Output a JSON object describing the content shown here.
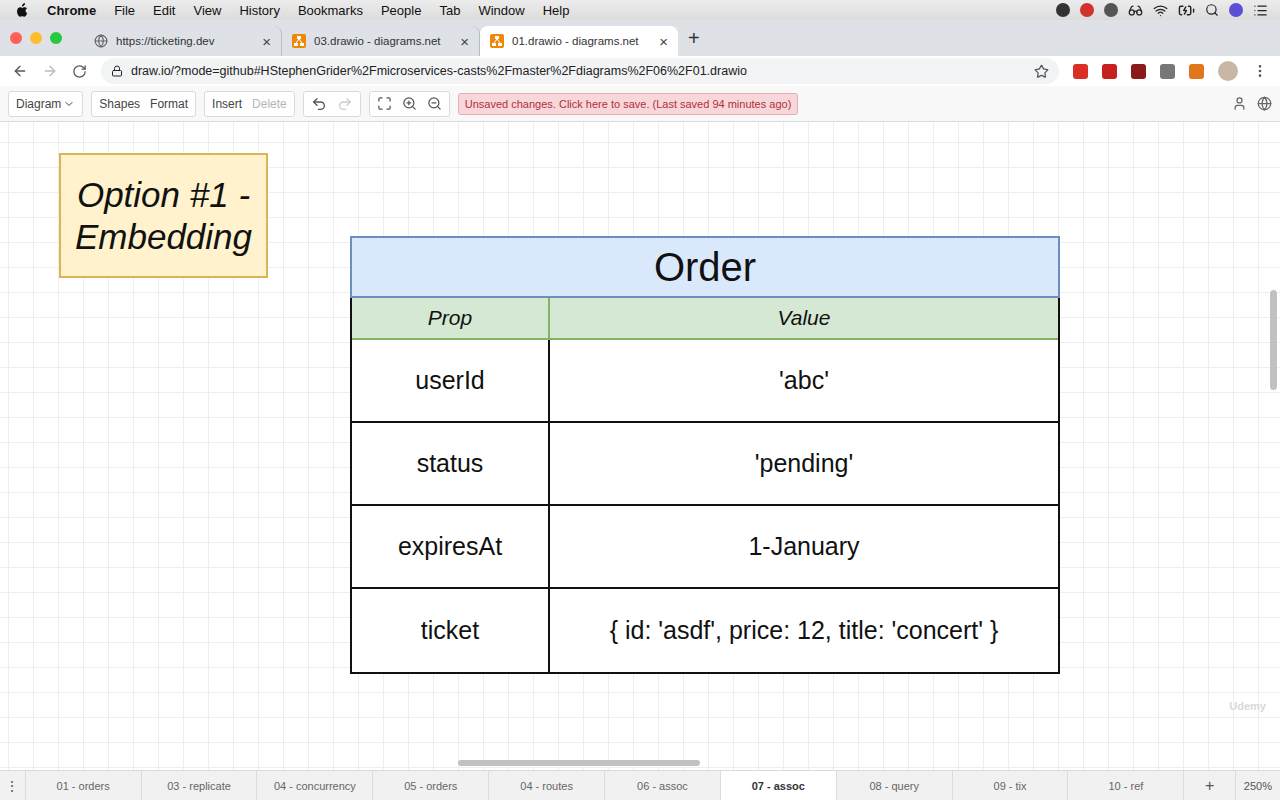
{
  "menubar": {
    "app": "Chrome",
    "items": [
      "File",
      "Edit",
      "View",
      "History",
      "Bookmarks",
      "People",
      "Tab",
      "Window",
      "Help"
    ]
  },
  "browser": {
    "tabs": [
      {
        "title": "https://ticketing.dev",
        "selected": false,
        "kind": "site"
      },
      {
        "title": "03.drawio - diagrams.net",
        "selected": false,
        "kind": "drawio"
      },
      {
        "title": "01.drawio - diagrams.net",
        "selected": true,
        "kind": "drawio"
      }
    ],
    "close": "×",
    "new_tab": "+",
    "url": "draw.io/?mode=github#HStephenGrider%2Fmicroservices-casts%2Fmaster%2Fdiagrams%2F06%2F01.drawio"
  },
  "toolbar": {
    "groups": [
      [
        {
          "label": "Diagram",
          "disabled": false,
          "dropdown": true
        }
      ],
      [
        {
          "label": "Shapes",
          "disabled": false,
          "dropdown": false
        },
        {
          "label": "Format",
          "disabled": false,
          "dropdown": false
        }
      ],
      [
        {
          "label": "Insert",
          "disabled": false,
          "dropdown": false
        },
        {
          "label": "Delete",
          "disabled": true,
          "dropdown": false
        }
      ]
    ],
    "undo": {
      "disabled": false
    },
    "redo": {
      "disabled": true
    },
    "notice": "Unsaved changes. Click here to save. (Last saved 94 minutes ago)"
  },
  "diagram": {
    "label": "Option #1 - Embedding",
    "table": {
      "title": "Order",
      "columns": [
        "Prop",
        "Value"
      ],
      "rows": [
        {
          "prop": "userId",
          "value": "'abc'"
        },
        {
          "prop": "status",
          "value": "'pending'"
        },
        {
          "prop": "expiresAt",
          "value": "1-January"
        },
        {
          "prop": "ticket",
          "value": "{ id: 'asdf', price: 12, title: 'concert' }"
        }
      ]
    }
  },
  "pages": {
    "menu": "⋮",
    "items": [
      {
        "label": "01 - orders",
        "selected": false
      },
      {
        "label": "03 - replicate",
        "selected": false
      },
      {
        "label": "04 - concurrency",
        "selected": false
      },
      {
        "label": "05 - orders",
        "selected": false
      },
      {
        "label": "04 - routes",
        "selected": false
      },
      {
        "label": "06 - assoc",
        "selected": false
      },
      {
        "label": "07 - assoc",
        "selected": true
      },
      {
        "label": "08 - query",
        "selected": false
      },
      {
        "label": "09 - tix",
        "selected": false
      },
      {
        "label": "10 - ref",
        "selected": false
      }
    ],
    "add": "+",
    "zoom": "250%"
  },
  "watermark": "Udemy"
}
